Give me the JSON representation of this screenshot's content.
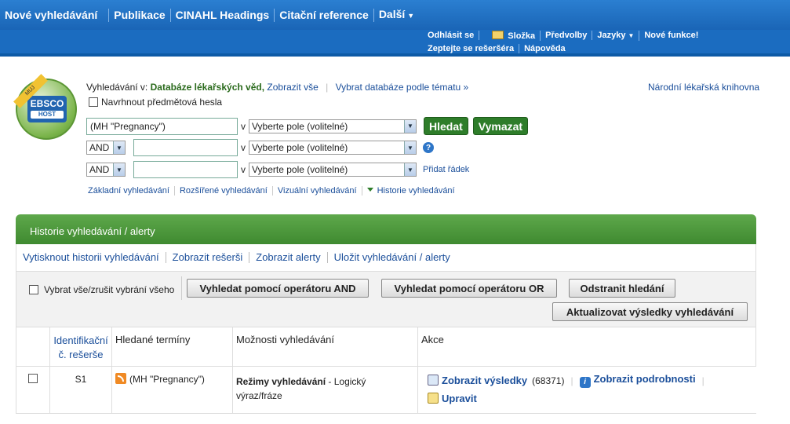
{
  "topnav": {
    "items": [
      "Nové vyhledávání",
      "Publikace",
      "CINAHL Headings",
      "Citační reference",
      "Další"
    ]
  },
  "utility": {
    "row1": [
      "Odhlásit se",
      "Složka",
      "Předvolby",
      "Jazyky",
      "Nové funkce!"
    ],
    "row2": [
      "Zeptejte se rešeršéra",
      "Nápověda"
    ]
  },
  "logo": {
    "ribbon": "MUJ",
    "line1": "EBSCO",
    "line2": "HOST"
  },
  "search": {
    "searching_in_label": "Vyhledávání v:",
    "database": "Databáze lékařských věd,",
    "show_all": "Zobrazit vše",
    "choose_db": "Vybrat databáze podle tématu »",
    "library": "Národní lékařská knihovna",
    "suggest_label": "Navrhnout předmětová hesla",
    "row1_value": "(MH \"Pregnancy\")",
    "in_label": "v",
    "field_placeholder": "Vyberte pole (volitelné)",
    "bool_op": "AND",
    "search_button": "Hledat",
    "clear_button": "Vymazat",
    "add_row": "Přidat řádek",
    "help": "?"
  },
  "modes": [
    "Základní vyhledávání",
    "Rozšířené vyhledávání",
    "Vizuální vyhledávání",
    "Historie vyhledávání"
  ],
  "history": {
    "title": "Historie vyhledávání / alerty",
    "links": [
      "Vytisknout historii vyhledávání",
      "Zobrazit rešerši",
      "Zobrazit alerty",
      "Uložit vyhledávání / alerty"
    ],
    "select_all": "Vybrat vše/zrušit vybrání všeho",
    "btn_and": "Vyhledat pomocí operátoru AND",
    "btn_or": "Vyhledat pomocí operátoru OR",
    "btn_remove": "Odstranit hledání",
    "btn_update": "Aktualizovat výsledky vyhledávání",
    "columns": {
      "id": "Identifikační č. rešerše",
      "terms": "Hledané termíny",
      "options": "Možnosti vyhledávání",
      "actions": "Akce"
    },
    "rows": [
      {
        "id": "S1",
        "terms": "(MH \"Pregnancy\")",
        "mode_label": "Režimy vyhledávání",
        "mode_value": " - Logický výraz/fráze",
        "show_results": "Zobrazit výsledky",
        "count": "(68371)",
        "show_details": "Zobrazit podrobnosti",
        "edit": "Upravit"
      }
    ]
  }
}
